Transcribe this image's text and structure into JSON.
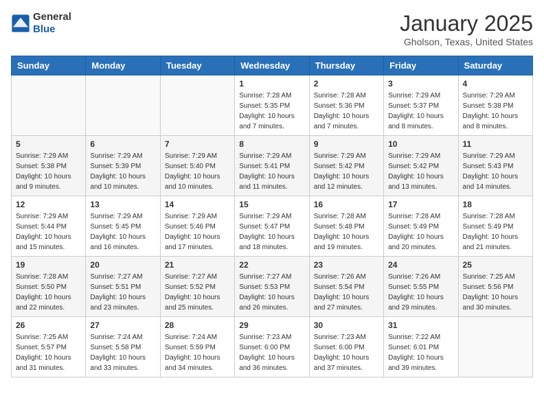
{
  "header": {
    "logo_line1": "General",
    "logo_line2": "Blue",
    "month_title": "January 2025",
    "location": "Gholson, Texas, United States"
  },
  "weekdays": [
    "Sunday",
    "Monday",
    "Tuesday",
    "Wednesday",
    "Thursday",
    "Friday",
    "Saturday"
  ],
  "weeks": [
    [
      {
        "day": "",
        "info": ""
      },
      {
        "day": "",
        "info": ""
      },
      {
        "day": "",
        "info": ""
      },
      {
        "day": "1",
        "info": "Sunrise: 7:28 AM\nSunset: 5:35 PM\nDaylight: 10 hours\nand 7 minutes."
      },
      {
        "day": "2",
        "info": "Sunrise: 7:28 AM\nSunset: 5:36 PM\nDaylight: 10 hours\nand 7 minutes."
      },
      {
        "day": "3",
        "info": "Sunrise: 7:29 AM\nSunset: 5:37 PM\nDaylight: 10 hours\nand 8 minutes."
      },
      {
        "day": "4",
        "info": "Sunrise: 7:29 AM\nSunset: 5:38 PM\nDaylight: 10 hours\nand 8 minutes."
      }
    ],
    [
      {
        "day": "5",
        "info": "Sunrise: 7:29 AM\nSunset: 5:38 PM\nDaylight: 10 hours\nand 9 minutes."
      },
      {
        "day": "6",
        "info": "Sunrise: 7:29 AM\nSunset: 5:39 PM\nDaylight: 10 hours\nand 10 minutes."
      },
      {
        "day": "7",
        "info": "Sunrise: 7:29 AM\nSunset: 5:40 PM\nDaylight: 10 hours\nand 10 minutes."
      },
      {
        "day": "8",
        "info": "Sunrise: 7:29 AM\nSunset: 5:41 PM\nDaylight: 10 hours\nand 11 minutes."
      },
      {
        "day": "9",
        "info": "Sunrise: 7:29 AM\nSunset: 5:42 PM\nDaylight: 10 hours\nand 12 minutes."
      },
      {
        "day": "10",
        "info": "Sunrise: 7:29 AM\nSunset: 5:42 PM\nDaylight: 10 hours\nand 13 minutes."
      },
      {
        "day": "11",
        "info": "Sunrise: 7:29 AM\nSunset: 5:43 PM\nDaylight: 10 hours\nand 14 minutes."
      }
    ],
    [
      {
        "day": "12",
        "info": "Sunrise: 7:29 AM\nSunset: 5:44 PM\nDaylight: 10 hours\nand 15 minutes."
      },
      {
        "day": "13",
        "info": "Sunrise: 7:29 AM\nSunset: 5:45 PM\nDaylight: 10 hours\nand 16 minutes."
      },
      {
        "day": "14",
        "info": "Sunrise: 7:29 AM\nSunset: 5:46 PM\nDaylight: 10 hours\nand 17 minutes."
      },
      {
        "day": "15",
        "info": "Sunrise: 7:29 AM\nSunset: 5:47 PM\nDaylight: 10 hours\nand 18 minutes."
      },
      {
        "day": "16",
        "info": "Sunrise: 7:28 AM\nSunset: 5:48 PM\nDaylight: 10 hours\nand 19 minutes."
      },
      {
        "day": "17",
        "info": "Sunrise: 7:28 AM\nSunset: 5:49 PM\nDaylight: 10 hours\nand 20 minutes."
      },
      {
        "day": "18",
        "info": "Sunrise: 7:28 AM\nSunset: 5:49 PM\nDaylight: 10 hours\nand 21 minutes."
      }
    ],
    [
      {
        "day": "19",
        "info": "Sunrise: 7:28 AM\nSunset: 5:50 PM\nDaylight: 10 hours\nand 22 minutes."
      },
      {
        "day": "20",
        "info": "Sunrise: 7:27 AM\nSunset: 5:51 PM\nDaylight: 10 hours\nand 23 minutes."
      },
      {
        "day": "21",
        "info": "Sunrise: 7:27 AM\nSunset: 5:52 PM\nDaylight: 10 hours\nand 25 minutes."
      },
      {
        "day": "22",
        "info": "Sunrise: 7:27 AM\nSunset: 5:53 PM\nDaylight: 10 hours\nand 26 minutes."
      },
      {
        "day": "23",
        "info": "Sunrise: 7:26 AM\nSunset: 5:54 PM\nDaylight: 10 hours\nand 27 minutes."
      },
      {
        "day": "24",
        "info": "Sunrise: 7:26 AM\nSunset: 5:55 PM\nDaylight: 10 hours\nand 29 minutes."
      },
      {
        "day": "25",
        "info": "Sunrise: 7:25 AM\nSunset: 5:56 PM\nDaylight: 10 hours\nand 30 minutes."
      }
    ],
    [
      {
        "day": "26",
        "info": "Sunrise: 7:25 AM\nSunset: 5:57 PM\nDaylight: 10 hours\nand 31 minutes."
      },
      {
        "day": "27",
        "info": "Sunrise: 7:24 AM\nSunset: 5:58 PM\nDaylight: 10 hours\nand 33 minutes."
      },
      {
        "day": "28",
        "info": "Sunrise: 7:24 AM\nSunset: 5:59 PM\nDaylight: 10 hours\nand 34 minutes."
      },
      {
        "day": "29",
        "info": "Sunrise: 7:23 AM\nSunset: 6:00 PM\nDaylight: 10 hours\nand 36 minutes."
      },
      {
        "day": "30",
        "info": "Sunrise: 7:23 AM\nSunset: 6:00 PM\nDaylight: 10 hours\nand 37 minutes."
      },
      {
        "day": "31",
        "info": "Sunrise: 7:22 AM\nSunset: 6:01 PM\nDaylight: 10 hours\nand 39 minutes."
      },
      {
        "day": "",
        "info": ""
      }
    ]
  ]
}
